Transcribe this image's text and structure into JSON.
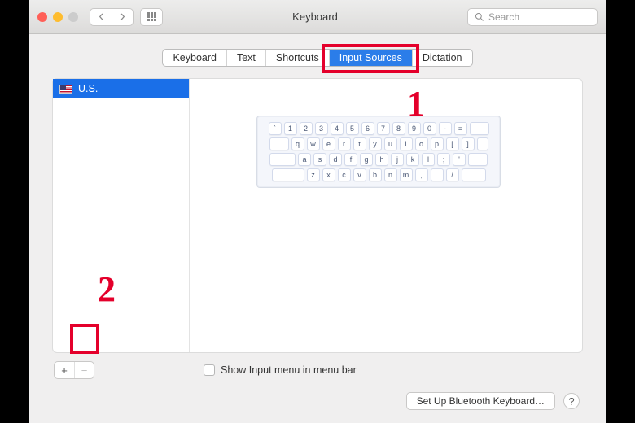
{
  "window": {
    "title": "Keyboard"
  },
  "search": {
    "placeholder": "Search"
  },
  "tabs": [
    {
      "label": "Keyboard",
      "active": false
    },
    {
      "label": "Text",
      "active": false
    },
    {
      "label": "Shortcuts",
      "active": false
    },
    {
      "label": "Input Sources",
      "active": true
    },
    {
      "label": "Dictation",
      "active": false
    }
  ],
  "sources": {
    "selected": "U.S."
  },
  "keyboard_rows": [
    [
      "`",
      "1",
      "2",
      "3",
      "4",
      "5",
      "6",
      "7",
      "8",
      "9",
      "0",
      "-",
      "="
    ],
    [
      "q",
      "w",
      "e",
      "r",
      "t",
      "y",
      "u",
      "i",
      "o",
      "p",
      "[",
      "]"
    ],
    [
      "a",
      "s",
      "d",
      "f",
      "g",
      "h",
      "j",
      "k",
      "l",
      ";",
      "'"
    ],
    [
      "z",
      "x",
      "c",
      "v",
      "b",
      "n",
      "m",
      ",",
      ".",
      "/"
    ]
  ],
  "checkbox": {
    "label": "Show Input menu in menu bar",
    "checked": false
  },
  "buttons": {
    "add": "+",
    "remove": "−",
    "bluetooth": "Set Up Bluetooth Keyboard…",
    "help": "?"
  },
  "annotations": {
    "one": "1",
    "two": "2"
  },
  "colors": {
    "highlight": "#e4002b",
    "tab_active": "#2b7de9"
  }
}
